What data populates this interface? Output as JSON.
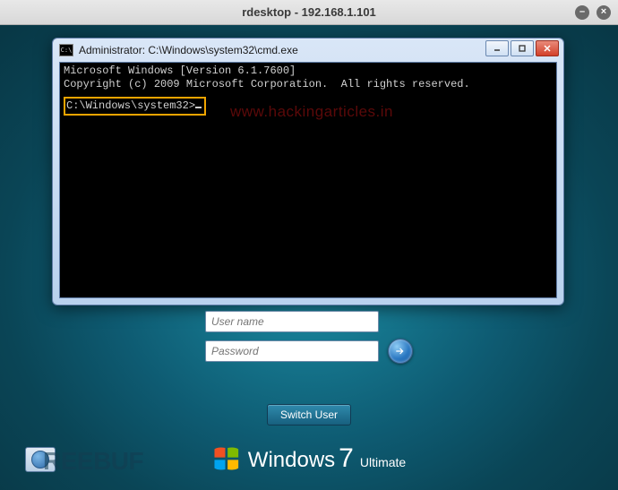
{
  "outer_window": {
    "title": "rdesktop - 192.168.1.101"
  },
  "cmd": {
    "icon_text": "C:\\",
    "title": "Administrator: C:\\Windows\\system32\\cmd.exe",
    "line1": "Microsoft Windows [Version 6.1.7600]",
    "line2": "Copyright (c) 2009 Microsoft Corporation.  All rights reserved.",
    "prompt": "C:\\Windows\\system32>",
    "watermark": "www.hackingarticles.in"
  },
  "login": {
    "username_placeholder": "User name",
    "password_placeholder": "Password",
    "switch_user_label": "Switch User"
  },
  "branding": {
    "windows": "Windows",
    "seven": "7",
    "edition": "Ultimate"
  },
  "bottom_watermark": "REEBUF"
}
